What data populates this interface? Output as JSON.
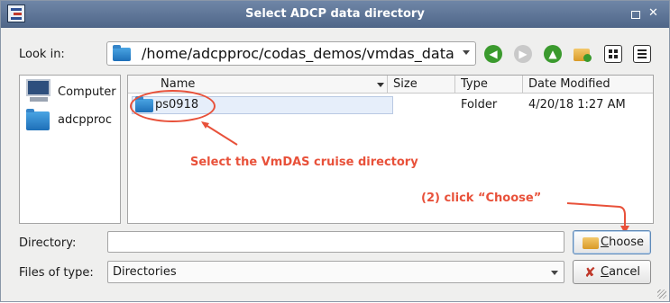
{
  "window": {
    "title": "Select ADCP data directory",
    "controls": {
      "maximize": "maximize-icon",
      "close": "close-icon"
    }
  },
  "lookin": {
    "label": "Look in:",
    "path": "/home/adcpproc/codas_demos/vmdas_data"
  },
  "toolbar": {
    "buttons": [
      "back-icon",
      "forward-icon",
      "up-folder-icon",
      "new-folder-icon",
      "list-view-icon",
      "details-view-icon"
    ]
  },
  "sidebar": {
    "items": [
      {
        "label": "Computer",
        "icon": "computer-icon"
      },
      {
        "label": "adcpproc",
        "icon": "folder-icon"
      }
    ]
  },
  "filelist": {
    "columns": [
      "Name",
      "Size",
      "Type",
      "Date Modified"
    ],
    "rows": [
      {
        "name": "ps0918",
        "size": "",
        "type": "Folder",
        "date": "4/20/18 1:27 AM"
      }
    ]
  },
  "annotations": {
    "select_hint": "Select the VmDAS cruise directory",
    "choose_hint": "(2) click “Choose”",
    "color": "#e8513a"
  },
  "directory": {
    "label": "Directory:",
    "value": ""
  },
  "filetype": {
    "label": "Files of type:",
    "value": "Directories"
  },
  "buttons": {
    "choose": "Choose",
    "cancel": "Cancel"
  }
}
